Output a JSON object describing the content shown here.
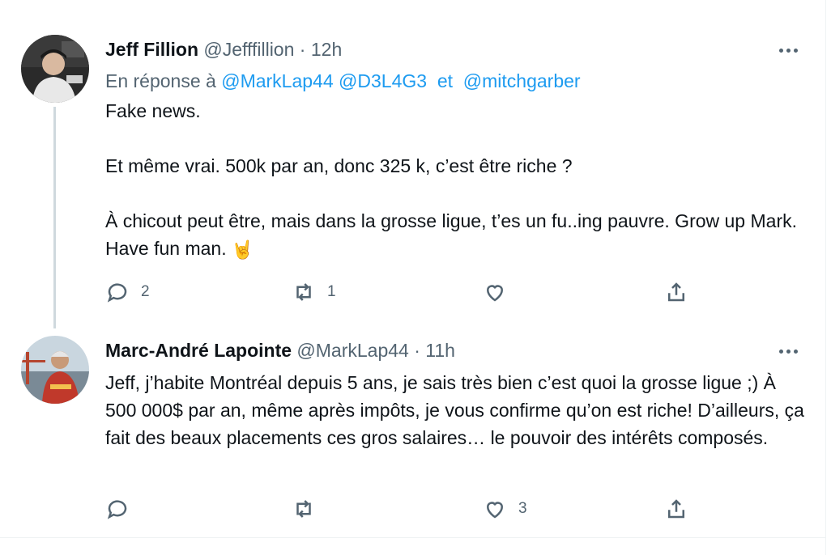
{
  "tweets": [
    {
      "display_name": "Jeff Fillion",
      "handle": "@Jefffillion",
      "separator": "·",
      "time": "12h",
      "reply_prefix": "En réponse à",
      "reply_mentions": [
        "@MarkLap44",
        "@D3L4G3",
        "@mitchgarber"
      ],
      "reply_conjunction": "et",
      "body": [
        "Fake news.",
        "Et même vrai. 500k par an, donc 325 k, c’est être riche ?",
        "À chicout peut être, mais dans la grosse ligue, t’es un fu..ing pauvre. Grow up Mark. Have fun man."
      ],
      "emoji": "🤘",
      "counts": {
        "reply": "2",
        "retweet": "1",
        "like": ""
      }
    },
    {
      "display_name": "Marc-André Lapointe",
      "handle": "@MarkLap44",
      "separator": "·",
      "time": "11h",
      "body": [
        "Jeff, j’habite Montréal depuis 5 ans, je sais très bien c’est quoi la grosse ligue ;) À 500 000$ par an, même après impôts, je vous confirme qu’on est riche! D’ailleurs, ça fait des beaux placements ces gros salaires… le pouvoir des intérêts composés."
      ],
      "counts": {
        "reply": "",
        "retweet": "",
        "like": "3"
      }
    }
  ],
  "icons": [
    "more-icon",
    "reply-icon",
    "retweet-icon",
    "like-icon",
    "share-icon"
  ],
  "colors": {
    "text": "#0f1419",
    "meta": "#536471",
    "link": "#1d9bf0",
    "thread_line": "#cfd9de",
    "border": "#eff3f4"
  }
}
